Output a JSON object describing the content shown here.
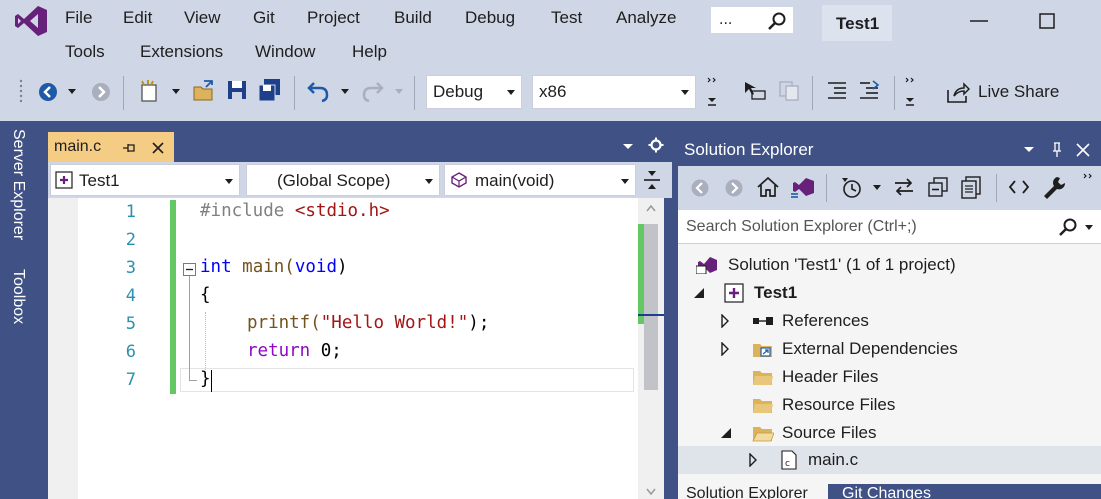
{
  "menu": {
    "row1": [
      "File",
      "Edit",
      "View",
      "Git",
      "Project",
      "Build",
      "Debug",
      "Test",
      "Analyze"
    ],
    "row2": [
      "Tools",
      "Extensions",
      "Window",
      "Help"
    ]
  },
  "search": {
    "text": "..."
  },
  "solution_name": "Test1",
  "toolbar": {
    "config": "Debug",
    "platform": "x86",
    "live_share": "Live Share"
  },
  "side_tabs": [
    "Server Explorer",
    "Toolbox"
  ],
  "editor": {
    "tab_label": "main.c",
    "nav": {
      "project": "Test1",
      "scope": "(Global Scope)",
      "member": "main(void)"
    },
    "line_numbers": [
      "1",
      "2",
      "3",
      "4",
      "5",
      "6",
      "7"
    ],
    "code": {
      "l1_directive": "#include",
      "l1_header": "<stdio.h>",
      "l3_type": "int",
      "l3_name": "main(",
      "l3_param": "void",
      "l3_close": ")",
      "l4": "{",
      "l5_func": "printf(",
      "l5_string": "\"Hello World!\"",
      "l5_end": ");",
      "l6_kw": "return",
      "l6_rest": " 0;",
      "l7": "}"
    }
  },
  "solution_explorer": {
    "title": "Solution Explorer",
    "search_placeholder": "Search Solution Explorer (Ctrl+;)",
    "tree": {
      "solution": "Solution 'Test1' (1 of 1 project)",
      "project": "Test1",
      "references": "References",
      "external_deps": "External Dependencies",
      "header_files": "Header Files",
      "resource_files": "Resource Files",
      "source_files": "Source Files",
      "main_c": "main.c"
    },
    "bottom_tabs": [
      "Solution Explorer",
      "Git Changes"
    ]
  },
  "colors": {
    "accent": "#68217a",
    "chrome": "#cfd6e5",
    "panel_dark": "#3f5185",
    "active_tab": "#f5cc84",
    "keyword": "#0000ff",
    "string": "#a31515",
    "line_number": "#2b91af"
  }
}
